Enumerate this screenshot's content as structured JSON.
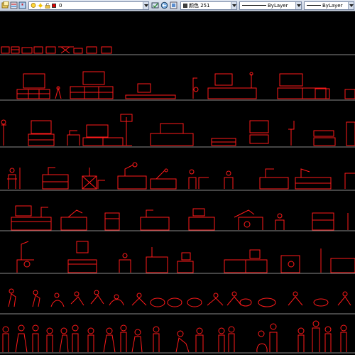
{
  "toolbar": {
    "layer_combo": {
      "value": "0",
      "color_swatch": "#e00000"
    },
    "color_combo": {
      "value": "颜色 251",
      "swatch": "#404040"
    },
    "linetype_combo": {
      "value": "ByLayer"
    },
    "lineweight_combo": {
      "value": "ByLayer"
    },
    "icons": [
      "layer-manager-icon",
      "layer-state-icon",
      "freeze-icon",
      "lightbulb-icon",
      "sun-icon",
      "lock-icon",
      "layer-color-icon",
      "make-current-icon",
      "layer-previous-icon",
      "layer-iso-icon"
    ]
  },
  "drawing": {
    "background": "#000000",
    "line_color": "#ff1a1a",
    "separator_color": "#8a8a8a",
    "rows": [
      {
        "name": "row-small-furniture-fronts"
      },
      {
        "name": "row-tv-cabinets"
      },
      {
        "name": "row-tv-consoles"
      },
      {
        "name": "row-desks-with-lamps"
      },
      {
        "name": "row-computer-desks"
      },
      {
        "name": "row-study-desks"
      },
      {
        "name": "row-people-plan-view"
      },
      {
        "name": "row-people-elevation"
      }
    ]
  }
}
